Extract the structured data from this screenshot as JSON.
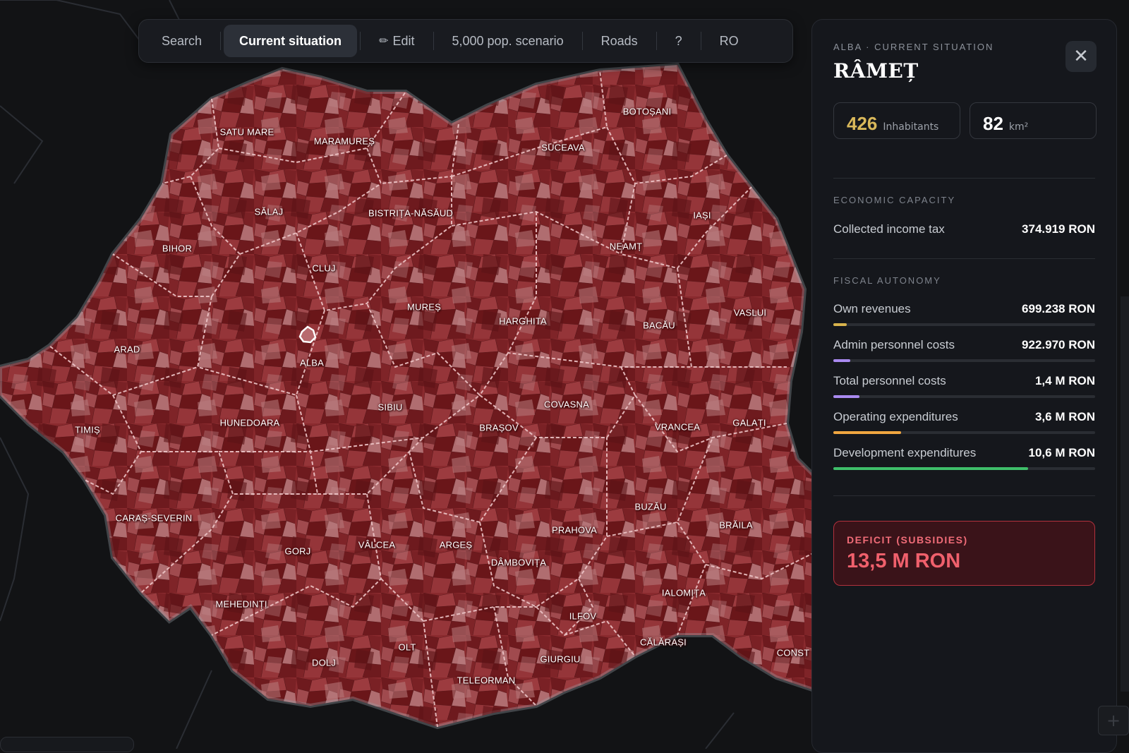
{
  "toolbar": {
    "items": [
      {
        "label": "Search",
        "active": false
      },
      {
        "label": "Current situation",
        "active": true
      },
      {
        "label": "Edit",
        "icon": "pencil-icon",
        "active": false
      },
      {
        "label": "5,000 pop. scenario",
        "active": false
      },
      {
        "label": "Roads",
        "active": false
      },
      {
        "label": "?",
        "active": false
      },
      {
        "label": "RO",
        "active": false
      }
    ]
  },
  "map": {
    "counties": [
      "SATU MARE",
      "MARAMUREȘ",
      "BOTOȘANI",
      "SUCEAVA",
      "SĂLAJ",
      "BISTRIȚA-NĂSĂUD",
      "IAȘI",
      "BIHOR",
      "NEAMȚ",
      "CLUJ",
      "MUREȘ",
      "HARGHITA",
      "BACĂU",
      "VASLUI",
      "ARAD",
      "ALBA",
      "SIBIU",
      "COVASNA",
      "TIMIȘ",
      "HUNEDOARA",
      "BRAȘOV",
      "VRANCEA",
      "GALAȚI",
      "BUZĂU",
      "BRĂILA",
      "CARAȘ-SEVERIN",
      "PRAHOVA",
      "GORJ",
      "VÂLCEA",
      "ARGEȘ",
      "DÂMBOVIȚA",
      "IALOMIȚA",
      "MEHEDINȚI",
      "ILFOV",
      "CĂLĂRAȘI",
      "OLT",
      "DOLJ",
      "GIURGIU",
      "TELEORMAN",
      "CONST"
    ],
    "colors": {
      "background": "#121315",
      "fill_dark": "#6e1a1e",
      "fill_mid": "#8f3034",
      "fill_light": "#b06d70",
      "border": "#e9b6b8"
    }
  },
  "panel": {
    "breadcrumb": "ALBA · CURRENT SITUATION",
    "title": "RÂMEȚ",
    "close_icon": "close-icon",
    "inhabitants": {
      "value": "426",
      "unit": "Inhabitants"
    },
    "area": {
      "value": "82",
      "unit": "km²"
    },
    "economic_capacity": {
      "heading": "ECONOMIC CAPACITY",
      "rows": [
        {
          "label": "Collected income tax",
          "value": "374.919 RON"
        }
      ]
    },
    "fiscal_autonomy": {
      "heading": "FISCAL AUTONOMY",
      "rows": [
        {
          "label": "Own revenues",
          "value": "699.238 RON",
          "fraction": 0.05,
          "color": "#d8b34c"
        },
        {
          "label": "Admin personnel costs",
          "value": "922.970 RON",
          "fraction": 0.066,
          "color": "#a98af0"
        },
        {
          "label": "Total personnel costs",
          "value": "1,4 M RON",
          "fraction": 0.1,
          "color": "#a98af0"
        },
        {
          "label": "Operating expenditures",
          "value": "3,6 M RON",
          "fraction": 0.26,
          "color": "#f0a640"
        },
        {
          "label": "Development expenditures",
          "value": "10,6 M RON",
          "fraction": 0.745,
          "color": "#3fbf6a"
        }
      ]
    },
    "deficit": {
      "label": "DEFICIT (SUBSIDIES)",
      "value": "13,5 M RON"
    }
  }
}
